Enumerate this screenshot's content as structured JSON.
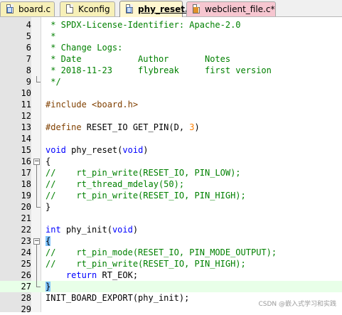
{
  "tabs": [
    {
      "label": "board.c",
      "icon": "c-file-icon"
    },
    {
      "label": "Kconfig",
      "icon": "text-file-icon"
    },
    {
      "label": "phy_reset.c",
      "icon": "c-file-icon",
      "active": true
    },
    {
      "label": "webclient_file.c*",
      "icon": "modified-file-icon"
    }
  ],
  "lines": [
    {
      "n": "4",
      "t": " * SPDX-License-Identifier: Apache-2.0"
    },
    {
      "n": "5",
      "t": " *"
    },
    {
      "n": "6",
      "t": " * Change Logs:"
    },
    {
      "n": "7",
      "t": " * Date           Author       Notes"
    },
    {
      "n": "8",
      "t": " * 2018-11-23     flybreak     first version"
    },
    {
      "n": "9",
      "t": " */"
    },
    {
      "n": "10",
      "t": ""
    },
    {
      "n": "11",
      "pre": "#include ",
      "rest": "<board.h>"
    },
    {
      "n": "12",
      "t": ""
    },
    {
      "n": "13",
      "pre": "#define ",
      "rest": "RESET_IO GET_PIN(D, ",
      "num": "3",
      "end": ")"
    },
    {
      "n": "14",
      "t": ""
    },
    {
      "n": "15",
      "kw1": "void",
      "mid": " phy_reset(",
      "kw2": "void",
      "end": ")"
    },
    {
      "n": "16",
      "t": "{"
    },
    {
      "n": "17",
      "t": "//    rt_pin_write(RESET_IO, PIN_LOW);"
    },
    {
      "n": "18",
      "t": "//    rt_thread_mdelay(50);"
    },
    {
      "n": "19",
      "t": "//    rt_pin_write(RESET_IO, PIN_HIGH);"
    },
    {
      "n": "20",
      "t": "}"
    },
    {
      "n": "21",
      "t": ""
    },
    {
      "n": "22",
      "kw1": "int",
      "mid": " phy_init(",
      "kw2": "void",
      "end": ")"
    },
    {
      "n": "23",
      "t": "{"
    },
    {
      "n": "24",
      "t": "//    rt_pin_mode(RESET_IO, PIN_MODE_OUTPUT);"
    },
    {
      "n": "25",
      "t": "//    rt_pin_write(RESET_IO, PIN_HIGH);"
    },
    {
      "n": "26",
      "ind": "    ",
      "kw1": "return",
      "mid": " RT_EOK;"
    },
    {
      "n": "27",
      "t": "}"
    },
    {
      "n": "28",
      "t": "INIT_BOARD_EXPORT(phy_init);"
    },
    {
      "n": "29",
      "t": ""
    }
  ],
  "watermark": "CSDN @嵌入式学习和实践",
  "colors": {
    "comment": "#008000",
    "keyword": "#0000ff",
    "preprocessor": "#804000",
    "number": "#ff8000",
    "current_line": "#e8ffe8"
  }
}
